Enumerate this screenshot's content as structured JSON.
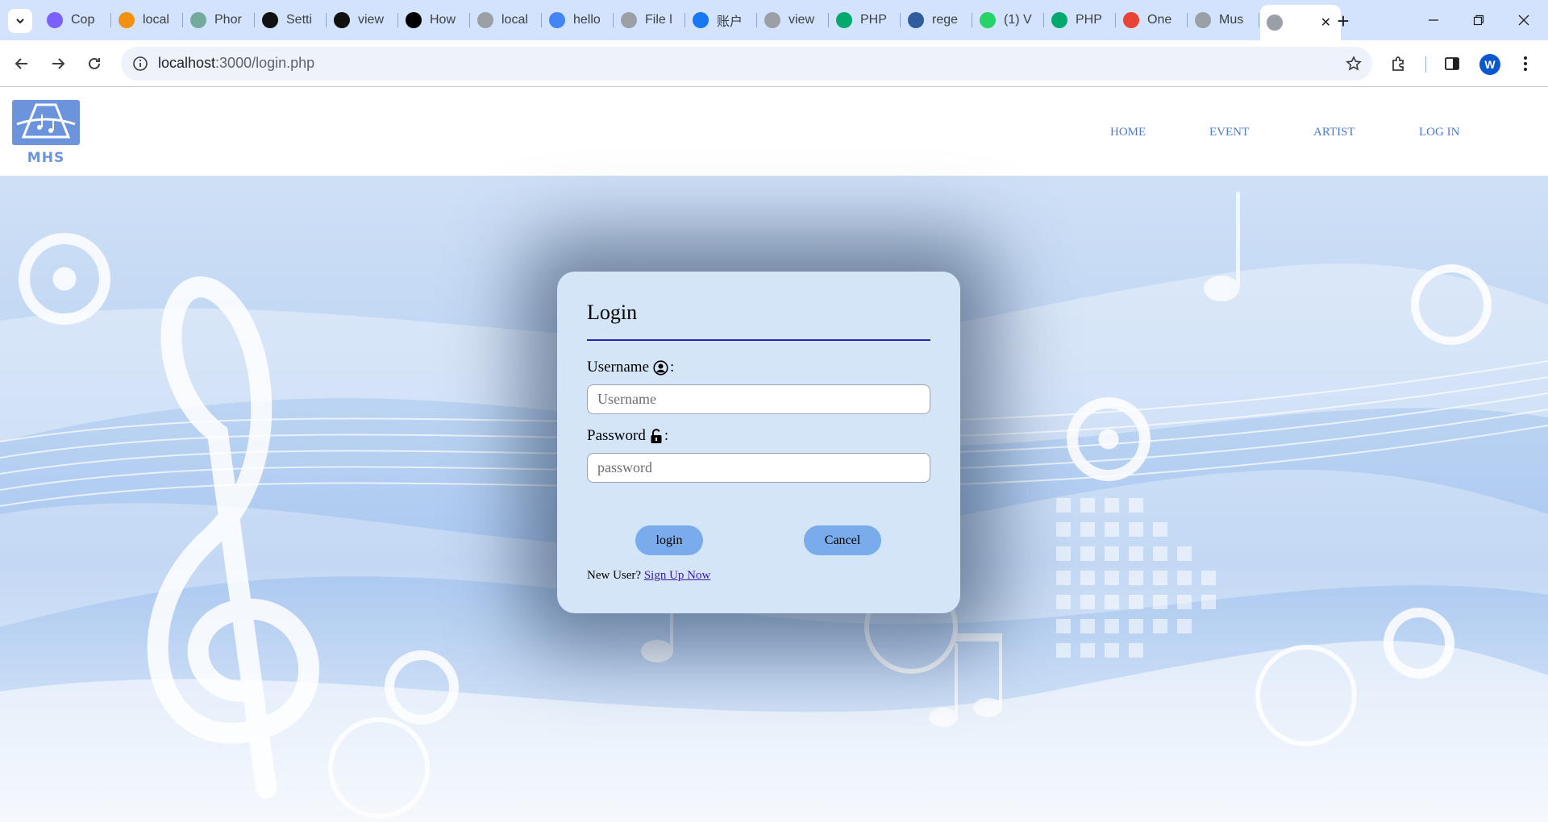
{
  "browser": {
    "tabs": [
      {
        "label": "Cop",
        "icon": "copilot-icon",
        "color": "#7b61ff"
      },
      {
        "label": "local",
        "icon": "phpmyadmin-icon",
        "color": "#f29111"
      },
      {
        "label": "Phor",
        "icon": "chatgpt-icon",
        "color": "#74aa9c"
      },
      {
        "label": "Setti",
        "icon": "codepen-icon",
        "color": "#111111"
      },
      {
        "label": "view",
        "icon": "codepen-icon",
        "color": "#111111"
      },
      {
        "label": "How",
        "icon": "medium-icon",
        "color": "#000000"
      },
      {
        "label": "local",
        "icon": "globe-icon",
        "color": "#9aa0a6"
      },
      {
        "label": "hello",
        "icon": "google-icon",
        "color": "#4285f4"
      },
      {
        "label": "File l",
        "icon": "globe-icon",
        "color": "#9aa0a6"
      },
      {
        "label": "账户",
        "icon": "facebook-icon",
        "color": "#1877f2"
      },
      {
        "label": "view",
        "icon": "globe-icon",
        "color": "#9aa0a6"
      },
      {
        "label": "PHP",
        "icon": "w3schools-icon",
        "color": "#04aa6d"
      },
      {
        "label": "rege",
        "icon": "r-icon",
        "color": "#2f5c9e"
      },
      {
        "label": "(1) V",
        "icon": "whatsapp-icon",
        "color": "#25d366"
      },
      {
        "label": "PHP",
        "icon": "w3schools-icon",
        "color": "#04aa6d"
      },
      {
        "label": "One",
        "icon": "maps-icon",
        "color": "#ea4335"
      },
      {
        "label": "Mus",
        "icon": "globe-icon",
        "color": "#9aa0a6"
      }
    ],
    "url_host": "localhost",
    "url_rest": ":3000/login.php",
    "profile_initial": "W"
  },
  "site": {
    "logo_text": "MHS",
    "nav": [
      "HOME",
      "EVENT",
      "ARTIST",
      "LOG IN"
    ]
  },
  "login": {
    "title": "Login",
    "username_label": "Username",
    "username_placeholder": "Username",
    "password_label": "Password",
    "password_placeholder": "password",
    "login_button": "login",
    "cancel_button": "Cancel",
    "new_user_text": "New User?",
    "signup_link": "Sign Up Now"
  }
}
